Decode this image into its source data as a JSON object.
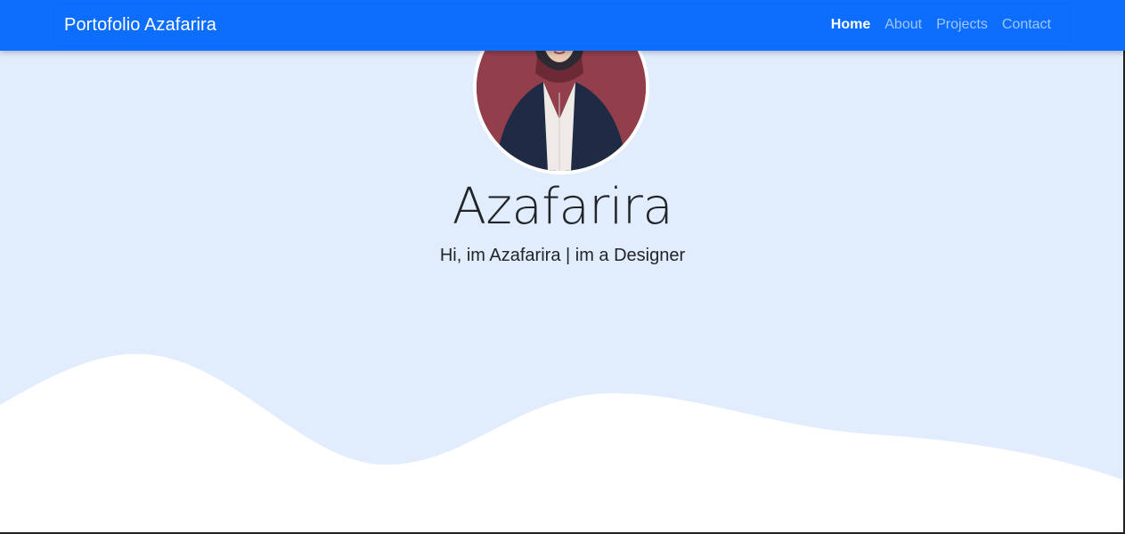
{
  "navbar": {
    "brand": "Portofolio Azafarira",
    "links": [
      {
        "label": "Home",
        "active": true
      },
      {
        "label": "About",
        "active": false
      },
      {
        "label": "Projects",
        "active": false
      },
      {
        "label": "Contact",
        "active": false
      }
    ]
  },
  "hero": {
    "name": "Azafarira",
    "subtitle": "Hi, im Azafarira | im a Designer",
    "avatar_icon": "profile-photo"
  },
  "colors": {
    "navbar": "#0d6efd",
    "hero_background": "#e1ecfd",
    "wave": "#ffffff",
    "text": "#212529"
  }
}
